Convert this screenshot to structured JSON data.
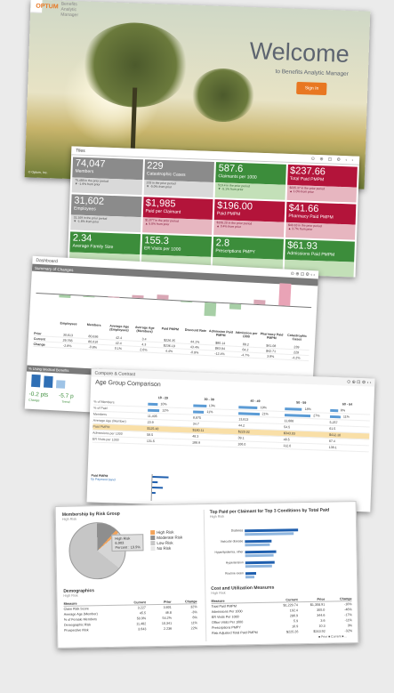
{
  "welcome": {
    "logo": "OPTUM",
    "app_name": "| Benefits Analytic Manager",
    "title": "Welcome",
    "subtitle": "to Benefits Analytic Manager",
    "signin_label": "Sign In",
    "footer": "© Optum, Inc."
  },
  "tiles_panel": {
    "title": "Tiles",
    "icons": "⊙ ⊕ ⊡ ⚙ ‹ ›",
    "tiles": [
      {
        "value": "74,047",
        "label": "Members",
        "l1": "75,488 in the prior period",
        "l2": "▼ -1.9% from prior",
        "color": "gray"
      },
      {
        "value": "229",
        "label": "Catastrophic Cases",
        "l1": "233 in the prior period",
        "l2": "▼ -5.0% from prior",
        "color": "gray"
      },
      {
        "value": "587.6",
        "label": "Claimants per 1000",
        "l1": "519.4 in the prior period",
        "l2": "▼ -5.1% from prior",
        "color": "green"
      },
      {
        "value": "$237.66",
        "label": "Total Paid PMPM",
        "l1": "$235.37 in the prior period",
        "l2": "▲ 1.0% from prior",
        "color": "red"
      },
      {
        "value": "31,602",
        "label": "Employees",
        "l1": "32,109 in the prior period",
        "l2": "▼ -1.6% from prior",
        "color": "gray"
      },
      {
        "value": "$1,985",
        "label": "Paid per Claimant",
        "l1": "$1,877 in the prior period",
        "l2": "▲ 5.8% from prior",
        "color": "red"
      },
      {
        "value": "$196.00",
        "label": "Paid PMPM",
        "l1": "$195.20 in the prior period",
        "l2": "▲ 0.4% from prior",
        "color": "red"
      },
      {
        "value": "$41.66",
        "label": "Pharmacy Paid PMPM",
        "l1": "$40.18 in the prior period",
        "l2": "▲ 3.7% from prior",
        "color": "red"
      },
      {
        "value": "2.34",
        "label": "Average Family Size",
        "l1": "",
        "l2": "",
        "color": "green"
      },
      {
        "value": "155.3",
        "label": "ER Visits per 1000",
        "l1": "",
        "l2": "",
        "color": "green"
      },
      {
        "value": "2.8",
        "label": "Prescriptions PMPY",
        "l1": "",
        "l2": "",
        "color": "green"
      },
      {
        "value": "$61.93",
        "label": "Admissions Paid PMPM",
        "l1": "",
        "l2": "",
        "color": "green"
      }
    ]
  },
  "dashboard": {
    "title": "Dashboard",
    "icons": "⊙ ⊕ ⊡ ⚙ ‹ ›",
    "section": "Summary of Changes",
    "categories": [
      "Employees",
      "Members",
      "Average Age (Employees)",
      "Average Age (Members)",
      "Paid PMPM",
      "Discount Rate",
      "Admission Paid PMPM",
      "Admission per 1000",
      "Pharmacy Paid PMPM",
      "Catastrophic Cases"
    ],
    "rows": [
      {
        "label": "Prior",
        "values": [
          "30,613",
          "80,636",
          "42.4",
          "3.4",
          "$226.35",
          "44.1%",
          "$80.14",
          "89.2",
          "$41.08",
          "239"
        ]
      },
      {
        "label": "Current",
        "values": [
          "29,766",
          "80,010",
          "42.4",
          "4.3",
          "$236.19",
          "43.4%",
          "$63.94",
          "64.2",
          "$42.71",
          "229"
        ]
      },
      {
        "label": "Change",
        "values": [
          "-2.8%",
          "-0.8%",
          "0.1%",
          "2.6%",
          "4.4%",
          "-0.9%",
          "-12.4%",
          "-4.7%",
          "3.9%",
          "-4.2%"
        ]
      }
    ],
    "change_pct": [
      -2.8,
      -0.8,
      0.1,
      2.6,
      4.4,
      -0.9,
      -12.4,
      -4.7,
      3.9,
      21
    ],
    "sub_panels": [
      "% Using Medical Benefits",
      "Total Paid PMPM",
      "Paid PMPM (CC)",
      "% of Paid (CC)"
    ],
    "mini_values": [
      "49.7%",
      "48.7%"
    ],
    "pts_a": "-0.2 pts",
    "pts_b": "-5.7 p",
    "pts_a_label": "Change",
    "pts_b_label": "Trend"
  },
  "compare": {
    "title": "Compare & Contrast",
    "icons": "⊙ ⊕ ⊡ ⚙ ‹ ›",
    "section": "Age Group Comparison",
    "columns": [
      "18 - 29",
      "30 - 39",
      "40 - 49",
      "50 - 59",
      "60 - 64"
    ],
    "bar_rows": [
      {
        "label": "% of Members",
        "values": [
          "10%",
          "13%",
          "19%",
          "18%",
          "8%"
        ],
        "pct": [
          10,
          13,
          19,
          18,
          8
        ]
      },
      {
        "label": "% of Paid",
        "values": [
          "12%",
          "11%",
          "21%",
          "27%",
          "11%"
        ],
        "pct": [
          12,
          11,
          21,
          27,
          11
        ]
      }
    ],
    "rows": [
      {
        "label": "Members",
        "values": [
          "11,405",
          "8,875",
          "13,813",
          "11,686",
          "5,257"
        ]
      },
      {
        "label": "Average Age (Member)",
        "values": [
          "23.9",
          "34.7",
          "44.2",
          "54.5",
          "61.5"
        ]
      },
      {
        "label": "Paid PMPM",
        "values": [
          "$125.48",
          "$180.11",
          "$220.02",
          "$343.03",
          "$412.10"
        ],
        "highlight": true
      },
      {
        "label": "Admissions per 1000",
        "values": [
          "58.5",
          "48.3",
          "39.1",
          "48.5",
          "67.4"
        ]
      },
      {
        "label": "ER Visits per 1000",
        "values": [
          "131.5",
          "188.9",
          "106.0",
          "112.0",
          "138.1"
        ]
      }
    ],
    "mini_title": "Paid PMPM",
    "mini_sub": "by Payment band"
  },
  "membership": {
    "left_title": "Membership by Risk Group",
    "left_sub": "High Risk",
    "tooltip_l1": "High Risk",
    "tooltip_l2": "6,903",
    "tooltip_l3": "Percent : 19.9%",
    "legend": [
      {
        "label": "High Risk",
        "color": "#f2a35a"
      },
      {
        "label": "Moderate Risk",
        "color": "#8e8e8e"
      },
      {
        "label": "Low Risk",
        "color": "#c6c6c6"
      },
      {
        "label": "No Risk",
        "color": "#e6e6e6"
      }
    ],
    "demo_title": "Demographics",
    "demo_sub": "High Risk",
    "demo_head": [
      "Measure",
      "Current",
      "Prior",
      "Change"
    ],
    "demo_rows": [
      [
        "Claim Risk Score",
        "3.227",
        "3.801",
        "32%"
      ],
      [
        "Average Age (Member)",
        "45.5",
        "46.8",
        "-3%"
      ],
      [
        "% of Female Members",
        "50.9%",
        "54.2%",
        "6%"
      ],
      [
        "Demographic Risk",
        "11,482",
        "10,341",
        "11%"
      ],
      [
        "Prospective Risk",
        "3.643",
        "2.236",
        "22%"
      ]
    ],
    "right_title": "Top Paid per Claimant for Top 3 Conditions by Total Paid",
    "right_sub": "High Risk",
    "conditions": [
      {
        "label": "Diabetes",
        "current": 0.6,
        "prior": 0.55
      },
      {
        "label": "Vascular disease",
        "current": 0.3,
        "prior": 0.28
      },
      {
        "label": "Hyperlipidemia, other",
        "current": 0.35,
        "prior": 0.32
      },
      {
        "label": "Hypertension",
        "current": 0.33,
        "prior": 0.3
      },
      {
        "label": "Routine exam",
        "current": 0.12,
        "prior": 0.1
      }
    ],
    "cost_title": "Cost and Utilization Measures",
    "cost_sub": "High Risk",
    "cost_head": [
      "Measure",
      "Current",
      "Prior",
      "Change"
    ],
    "cost_rows": [
      [
        "Total Paid PMPM",
        "$1,229.74",
        "$1,358.91",
        "-10%"
      ],
      [
        "Admissions Per 1000",
        "192.4",
        "355.0",
        "-46%"
      ],
      [
        "ER Visits Per 1000",
        "286.9",
        "344.6",
        "-17%"
      ],
      [
        "Office Visits Per 1000",
        "5.9",
        "3.6",
        "-11%"
      ],
      [
        "Prescriptions PMPY",
        "10.9",
        "10.3",
        "3%"
      ],
      [
        "Risk Adjusted Total Paid PMPM",
        "$225.26",
        "$243.92",
        "-32%"
      ]
    ],
    "footer_legend": "■ Prior  ■ Current  ■ ..."
  }
}
